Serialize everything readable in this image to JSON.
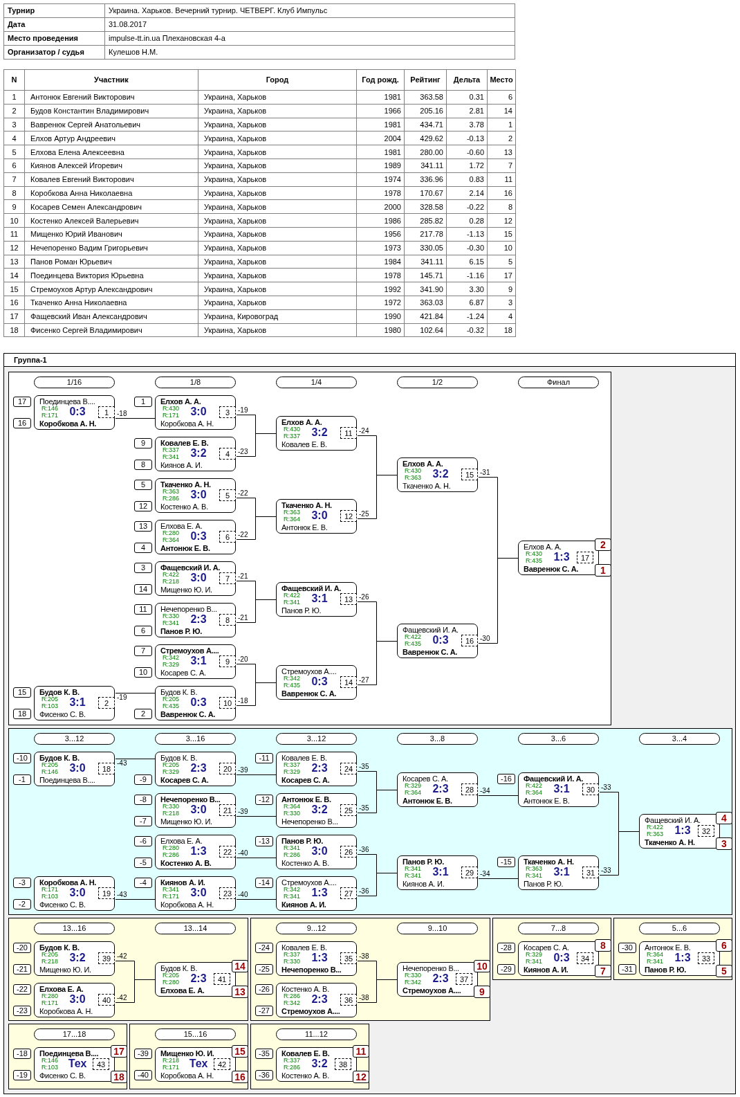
{
  "tournament_info": [
    {
      "label": "Турнир",
      "value": "Украина. Харьков. Вечерний турнир. ЧЕТВЕРГ. Клуб Импульс"
    },
    {
      "label": "Дата",
      "value": "31.08.2017"
    },
    {
      "label": "Место проведения",
      "value": "impulse-tt.in.ua Плехановская 4-а"
    },
    {
      "label": "Организатор / судья",
      "value": "Кулешов Н.М."
    }
  ],
  "participants": {
    "columns": [
      "N",
      "Участник",
      "Город",
      "Год рожд.",
      "Рейтинг",
      "Дельта",
      "Место"
    ],
    "rows": [
      [
        "1",
        "Антонюк Евгений Викторович",
        "Украина, Харьков",
        "1981",
        "363.58",
        "0.31",
        "6"
      ],
      [
        "2",
        "Будов Константин Владимирович",
        "Украина, Харьков",
        "1966",
        "205.16",
        "2.81",
        "14"
      ],
      [
        "3",
        "Вавренюк Сергей Анатольевич",
        "Украина, Харьков",
        "1981",
        "434.71",
        "3.78",
        "1"
      ],
      [
        "4",
        "Елхов Артур Андреевич",
        "Украина, Харьков",
        "2004",
        "429.62",
        "-0.13",
        "2"
      ],
      [
        "5",
        "Елхова Елена Алексеевна",
        "Украина, Харьков",
        "1981",
        "280.00",
        "-0.60",
        "13"
      ],
      [
        "6",
        "Киянов Алексей Игоревич",
        "Украина, Харьков",
        "1989",
        "341.11",
        "1.72",
        "7"
      ],
      [
        "7",
        "Ковалев Евгений Викторович",
        "Украина, Харьков",
        "1974",
        "336.96",
        "0.83",
        "11"
      ],
      [
        "8",
        "Коробкова Анна Николаевна",
        "Украина, Харьков",
        "1978",
        "170.67",
        "2.14",
        "16"
      ],
      [
        "9",
        "Косарев Семен Александрович",
        "Украина, Харьков",
        "2000",
        "328.58",
        "-0.22",
        "8"
      ],
      [
        "10",
        "Костенко Алексей Валерьевич",
        "Украина, Харьков",
        "1986",
        "285.82",
        "0.28",
        "12"
      ],
      [
        "11",
        "Мищенко Юрий Иванович",
        "Украина, Харьков",
        "1956",
        "217.78",
        "-1.13",
        "15"
      ],
      [
        "12",
        "Нечепоренко Вадим Григорьевич",
        "Украина, Харьков",
        "1973",
        "330.05",
        "-0.30",
        "10"
      ],
      [
        "13",
        "Панов Роман Юрьевич",
        "Украина, Харьков",
        "1984",
        "341.11",
        "6.15",
        "5"
      ],
      [
        "14",
        "Поединцева Виктория Юрьевна",
        "Украина, Харьков",
        "1978",
        "145.71",
        "-1.16",
        "17"
      ],
      [
        "15",
        "Стремоухов Артур Александрович",
        "Украина, Харьков",
        "1992",
        "341.90",
        "3.30",
        "9"
      ],
      [
        "16",
        "Ткаченко Анна Николаевна",
        "Украина, Харьков",
        "1972",
        "363.03",
        "6.87",
        "3"
      ],
      [
        "17",
        "Фащевский Иван Александрович",
        "Украина, Кировоград",
        "1990",
        "421.84",
        "-1.24",
        "4"
      ],
      [
        "18",
        "Фисенко Сергей Владимирович",
        "Украина, Харьков",
        "1980",
        "102.64",
        "-0.32",
        "18"
      ]
    ]
  },
  "group": {
    "title": "Группа-1",
    "panels": [
      {
        "color": "#ffffff",
        "rounds": [
          {
            "label": "1/16",
            "matches": [
              {
                "number": "1",
                "score": "0:3",
                "loser_to": "-18",
                "top": {
                  "source": "17",
                  "name": "Поединцева В....",
                  "rating": "R:146",
                  "winner": false
                },
                "bottom": {
                  "source": "16",
                  "name": "Коробкова А. Н.",
                  "rating": "R:171",
                  "winner": true
                }
              },
              {
                "number": "2",
                "score": "3:1",
                "loser_to": "-19",
                "top": {
                  "source": "15",
                  "name": "Будов К. В.",
                  "rating": "R:205",
                  "winner": true
                },
                "bottom": {
                  "source": "18",
                  "name": "Фисенко С. В.",
                  "rating": "R:103",
                  "winner": false
                }
              }
            ]
          },
          {
            "label": "1/8",
            "matches": [
              {
                "number": "3",
                "score": "3:0",
                "loser_to": "-19",
                "top": {
                  "source": "1",
                  "name": "Елхов А. А.",
                  "rating": "R:430",
                  "winner": true
                },
                "bottom": {
                  "name": "Коробкова А. Н.",
                  "rating": "R:171",
                  "winner": false
                }
              },
              {
                "number": "4",
                "score": "3:2",
                "loser_to": "-23",
                "top": {
                  "source": "9",
                  "name": "Ковалев Е. В.",
                  "rating": "R:337",
                  "winner": true
                },
                "bottom": {
                  "source": "8",
                  "name": "Киянов А. И.",
                  "rating": "R:341",
                  "winner": false
                }
              },
              {
                "number": "5",
                "score": "3:0",
                "loser_to": "-22",
                "top": {
                  "source": "5",
                  "name": "Ткаченко А. Н.",
                  "rating": "R:363",
                  "winner": true
                },
                "bottom": {
                  "source": "12",
                  "name": "Костенко А. В.",
                  "rating": "R:286",
                  "winner": false
                }
              },
              {
                "number": "6",
                "score": "0:3",
                "loser_to": "-22",
                "top": {
                  "source": "13",
                  "name": "Елхова Е. А.",
                  "rating": "R:280",
                  "winner": false
                },
                "bottom": {
                  "source": "4",
                  "name": "Антонюк Е. В.",
                  "rating": "R:364",
                  "winner": true
                }
              },
              {
                "number": "7",
                "score": "3:0",
                "loser_to": "-21",
                "top": {
                  "source": "3",
                  "name": "Фащевский И. А.",
                  "rating": "R:422",
                  "winner": true
                },
                "bottom": {
                  "source": "14",
                  "name": "Мищенко Ю. И.",
                  "rating": "R:218",
                  "winner": false
                }
              },
              {
                "number": "8",
                "score": "2:3",
                "loser_to": "-21",
                "top": {
                  "source": "11",
                  "name": "Нечепоренко В...",
                  "rating": "R:330",
                  "winner": false
                },
                "bottom": {
                  "source": "6",
                  "name": "Панов Р. Ю.",
                  "rating": "R:341",
                  "winner": true
                }
              },
              {
                "number": "9",
                "score": "3:1",
                "loser_to": "-20",
                "top": {
                  "source": "7",
                  "name": "Стремоухов А....",
                  "rating": "R:342",
                  "winner": true
                },
                "bottom": {
                  "source": "10",
                  "name": "Косарев С. А.",
                  "rating": "R:329",
                  "winner": false
                }
              },
              {
                "number": "10",
                "score": "0:3",
                "loser_to": "-18",
                "top": {
                  "name": "Будов К. В.",
                  "rating": "R:205",
                  "winner": false
                },
                "bottom": {
                  "source": "2",
                  "name": "Вавренюк С. А.",
                  "rating": "R:435",
                  "winner": true
                }
              }
            ]
          },
          {
            "label": "1/4",
            "matches": [
              {
                "number": "11",
                "score": "3:2",
                "loser_to": "-24",
                "top": {
                  "name": "Елхов А. А.",
                  "rating": "R:430",
                  "winner": true
                },
                "bottom": {
                  "name": "Ковалев Е. В.",
                  "rating": "R:337",
                  "winner": false
                }
              },
              {
                "number": "12",
                "score": "3:0",
                "loser_to": "-25",
                "top": {
                  "name": "Ткаченко А. Н.",
                  "rating": "R:363",
                  "winner": true
                },
                "bottom": {
                  "name": "Антонюк Е. В.",
                  "rating": "R:364",
                  "winner": false
                }
              },
              {
                "number": "13",
                "score": "3:1",
                "loser_to": "-26",
                "top": {
                  "name": "Фащевский И. А.",
                  "rating": "R:422",
                  "winner": true
                },
                "bottom": {
                  "name": "Панов Р. Ю.",
                  "rating": "R:341",
                  "winner": false
                }
              },
              {
                "number": "14",
                "score": "0:3",
                "loser_to": "-27",
                "top": {
                  "name": "Стремоухов А....",
                  "rating": "R:342",
                  "winner": false
                },
                "bottom": {
                  "name": "Вавренюк С. А.",
                  "rating": "R:435",
                  "winner": true
                }
              }
            ]
          },
          {
            "label": "1/2",
            "matches": [
              {
                "number": "15",
                "score": "3:2",
                "loser_to": "-31",
                "top": {
                  "name": "Елхов А. А.",
                  "rating": "R:430",
                  "winner": true
                },
                "bottom": {
                  "name": "Ткаченко А. Н.",
                  "rating": "R:363",
                  "winner": false
                }
              },
              {
                "number": "16",
                "score": "0:3",
                "loser_to": "-30",
                "top": {
                  "name": "Фащевский И. А.",
                  "rating": "R:422",
                  "winner": false
                },
                "bottom": {
                  "name": "Вавренюк С. А.",
                  "rating": "R:435",
                  "winner": true
                }
              }
            ]
          },
          {
            "label": "Финал",
            "matches": [
              {
                "number": "17",
                "score": "1:3",
                "top": {
                  "name": "Елхов А. А.",
                  "rating": "R:430",
                  "winner": false,
                  "place": "2"
                },
                "bottom": {
                  "name": "Вавренюк С. А.",
                  "rating": "R:435",
                  "winner": true,
                  "place": "1"
                }
              }
            ]
          }
        ]
      },
      {
        "color": "#e0ffff",
        "rounds": [
          {
            "label": "3...12",
            "matches": [
              {
                "number": "18",
                "score": "3:0",
                "loser_to": "-43",
                "top": {
                  "source": "-10",
                  "name": "Будов К. В.",
                  "rating": "R:205",
                  "winner": true
                },
                "bottom": {
                  "source": "-1",
                  "name": "Поединцева В....",
                  "rating": "R:146",
                  "winner": false
                }
              },
              {
                "number": "19",
                "score": "3:0",
                "loser_to": "-43",
                "top": {
                  "source": "-3",
                  "name": "Коробкова А. Н.",
                  "rating": "R:171",
                  "winner": true
                },
                "bottom": {
                  "source": "-2",
                  "name": "Фисенко С. В.",
                  "rating": "R:103",
                  "winner": false
                }
              }
            ]
          },
          {
            "label": "3...16",
            "matches": [
              {
                "number": "20",
                "score": "2:3",
                "loser_to": "-39",
                "top": {
                  "name": "Будов К. В.",
                  "rating": "R:205",
                  "winner": false
                },
                "bottom": {
                  "source": "-9",
                  "name": "Косарев С. А.",
                  "rating": "R:329",
                  "winner": true
                }
              },
              {
                "number": "21",
                "score": "3:0",
                "loser_to": "-39",
                "top": {
                  "source": "-8",
                  "name": "Нечепоренко В...",
                  "rating": "R:330",
                  "winner": true
                },
                "bottom": {
                  "source": "-7",
                  "name": "Мищенко Ю. И.",
                  "rating": "R:218",
                  "winner": false
                }
              },
              {
                "number": "22",
                "score": "1:3",
                "loser_to": "-40",
                "top": {
                  "source": "-6",
                  "name": "Елхова Е. А.",
                  "rating": "R:280",
                  "winner": false
                },
                "bottom": {
                  "source": "-5",
                  "name": "Костенко А. В.",
                  "rating": "R:286",
                  "winner": true
                }
              },
              {
                "number": "23",
                "score": "3:0",
                "loser_to": "-40",
                "top": {
                  "source": "-4",
                  "name": "Киянов А. И.",
                  "rating": "R:341",
                  "winner": true
                },
                "bottom": {
                  "name": "Коробкова А. Н.",
                  "rating": "R:171",
                  "winner": false
                }
              }
            ]
          },
          {
            "label": "3...12",
            "matches": [
              {
                "number": "24",
                "score": "2:3",
                "loser_to": "-35",
                "top": {
                  "source": "-11",
                  "name": "Ковалев Е. В.",
                  "rating": "R:337",
                  "winner": false
                },
                "bottom": {
                  "name": "Косарев С. А.",
                  "rating": "R:329",
                  "winner": true
                }
              },
              {
                "number": "25",
                "score": "3:2",
                "loser_to": "-35",
                "top": {
                  "source": "-12",
                  "name": "Антонюк Е. В.",
                  "rating": "R:364",
                  "winner": true
                },
                "bottom": {
                  "name": "Нечепоренко В...",
                  "rating": "R:330",
                  "winner": false
                }
              },
              {
                "number": "26",
                "score": "3:0",
                "loser_to": "-36",
                "top": {
                  "source": "-13",
                  "name": "Панов Р. Ю.",
                  "rating": "R:341",
                  "winner": true
                },
                "bottom": {
                  "name": "Костенко А. В.",
                  "rating": "R:286",
                  "winner": false
                }
              },
              {
                "number": "27",
                "score": "1:3",
                "loser_to": "-36",
                "top": {
                  "source": "-14",
                  "name": "Стремоухов А....",
                  "rating": "R:342",
                  "winner": false
                },
                "bottom": {
                  "name": "Киянов А. И.",
                  "rating": "R:341",
                  "winner": true
                }
              }
            ]
          },
          {
            "label": "3...8",
            "matches": [
              {
                "number": "28",
                "score": "2:3",
                "loser_to": "-34",
                "top": {
                  "name": "Косарев С. А.",
                  "rating": "R:329",
                  "winner": false
                },
                "bottom": {
                  "name": "Антонюк Е. В.",
                  "rating": "R:364",
                  "winner": true
                }
              },
              {
                "number": "29",
                "score": "3:1",
                "loser_to": "-34",
                "top": {
                  "name": "Панов Р. Ю.",
                  "rating": "R:341",
                  "winner": true
                },
                "bottom": {
                  "name": "Киянов А. И.",
                  "rating": "R:341",
                  "winner": false
                }
              }
            ]
          },
          {
            "label": "3...6",
            "matches": [
              {
                "number": "30",
                "score": "3:1",
                "loser_to": "-33",
                "top": {
                  "source": "-16",
                  "name": "Фащевский И. А.",
                  "rating": "R:422",
                  "winner": true
                },
                "bottom": {
                  "name": "Антонюк Е. В.",
                  "rating": "R:364",
                  "winner": false
                }
              },
              {
                "number": "31",
                "score": "3:1",
                "loser_to": "-33",
                "top": {
                  "source": "-15",
                  "name": "Ткаченко А. Н.",
                  "rating": "R:363",
                  "winner": true
                },
                "bottom": {
                  "name": "Панов Р. Ю.",
                  "rating": "R:341",
                  "winner": false
                }
              }
            ]
          },
          {
            "label": "3...4",
            "matches": [
              {
                "number": "32",
                "score": "1:3",
                "top": {
                  "name": "Фащевский И. А.",
                  "rating": "R:422",
                  "winner": false,
                  "place": "4"
                },
                "bottom": {
                  "name": "Ткаченко А. Н.",
                  "rating": "R:363",
                  "winner": true,
                  "place": "3"
                }
              }
            ]
          }
        ]
      },
      {
        "color": "#ffffe0",
        "rounds": [
          {
            "label": "13...16",
            "matches": [
              {
                "number": "39",
                "score": "3:2",
                "loser_to": "-42",
                "top": {
                  "source": "-20",
                  "name": "Будов К. В.",
                  "rating": "R:205",
                  "winner": true
                },
                "bottom": {
                  "source": "-21",
                  "name": "Мищенко Ю. И.",
                  "rating": "R:218",
                  "winner": false
                }
              },
              {
                "number": "40",
                "score": "3:0",
                "loser_to": "-42",
                "top": {
                  "source": "-22",
                  "name": "Елхова Е. А.",
                  "rating": "R:280",
                  "winner": true
                },
                "bottom": {
                  "source": "-23",
                  "name": "Коробкова А. Н.",
                  "rating": "R:171",
                  "winner": false
                }
              }
            ]
          },
          {
            "label": "13...14",
            "matches": [
              {
                "number": "41",
                "score": "2:3",
                "top": {
                  "name": "Будов К. В.",
                  "rating": "R:205",
                  "winner": false,
                  "place": "14"
                },
                "bottom": {
                  "name": "Елхова Е. А.",
                  "rating": "R:280",
                  "winner": true,
                  "place": "13"
                }
              }
            ]
          }
        ]
      },
      {
        "color": "#ffffe0",
        "rounds": [
          {
            "label": "9...12",
            "matches": [
              {
                "number": "35",
                "score": "1:3",
                "loser_to": "-38",
                "top": {
                  "source": "-24",
                  "name": "Ковалев Е. В.",
                  "rating": "R:337",
                  "winner": false
                },
                "bottom": {
                  "source": "-25",
                  "name": "Нечепоренко В...",
                  "rating": "R:330",
                  "winner": true
                }
              },
              {
                "number": "36",
                "score": "2:3",
                "loser_to": "-38",
                "top": {
                  "source": "-26",
                  "name": "Костенко А. В.",
                  "rating": "R:286",
                  "winner": false
                },
                "bottom": {
                  "source": "-27",
                  "name": "Стремоухов А....",
                  "rating": "R:342",
                  "winner": true
                }
              }
            ]
          },
          {
            "label": "9...10",
            "matches": [
              {
                "number": "37",
                "score": "2:3",
                "top": {
                  "name": "Нечепоренко В...",
                  "rating": "R:330",
                  "winner": false,
                  "place": "10"
                },
                "bottom": {
                  "name": "Стремоухов А....",
                  "rating": "R:342",
                  "winner": true,
                  "place": "9"
                }
              }
            ]
          }
        ]
      },
      {
        "color": "#ffffe0",
        "rounds": [
          {
            "label": "7...8",
            "matches": [
              {
                "number": "34",
                "score": "0:3",
                "top": {
                  "source": "-28",
                  "name": "Косарев С. А.",
                  "rating": "R:329",
                  "winner": false,
                  "place": "8"
                },
                "bottom": {
                  "source": "-29",
                  "name": "Киянов А. И.",
                  "rating": "R:341",
                  "winner": true,
                  "place": "7"
                }
              }
            ]
          }
        ]
      },
      {
        "color": "#ffffe0",
        "rounds": [
          {
            "label": "5...6",
            "matches": [
              {
                "number": "33",
                "score": "1:3",
                "top": {
                  "source": "-30",
                  "name": "Антонюк Е. В.",
                  "rating": "R:364",
                  "winner": false,
                  "place": "6"
                },
                "bottom": {
                  "source": "-31",
                  "name": "Панов Р. Ю.",
                  "rating": "R:341",
                  "winner": true,
                  "place": "5"
                }
              }
            ]
          }
        ]
      },
      {
        "color": "#ffffe0",
        "rounds": [
          {
            "label": "17...18",
            "matches": [
              {
                "number": "43",
                "score": "Тех",
                "top": {
                  "source": "-18",
                  "name": "Поединцева В....",
                  "rating": "R:146",
                  "winner": true,
                  "place": "17"
                },
                "bottom": {
                  "source": "-19",
                  "name": "Фисенко С. В.",
                  "rating": "R:103",
                  "winner": false,
                  "place": "18"
                }
              }
            ]
          }
        ]
      },
      {
        "color": "#ffffe0",
        "rounds": [
          {
            "label": "15...16",
            "matches": [
              {
                "number": "42",
                "score": "Тех",
                "top": {
                  "source": "-39",
                  "name": "Мищенко Ю. И.",
                  "rating": "R:218",
                  "winner": true,
                  "place": "15"
                },
                "bottom": {
                  "source": "-40",
                  "name": "Коробкова А. Н.",
                  "rating": "R:171",
                  "winner": false,
                  "place": "16"
                }
              }
            ]
          }
        ]
      },
      {
        "color": "#ffffe0",
        "rounds": [
          {
            "label": "11...12",
            "matches": [
              {
                "number": "38",
                "score": "3:2",
                "top": {
                  "source": "-35",
                  "name": "Ковалев Е. В.",
                  "rating": "R:337",
                  "winner": true,
                  "place": "11"
                },
                "bottom": {
                  "source": "-36",
                  "name": "Костенко А. В.",
                  "rating": "R:286",
                  "winner": false,
                  "place": "12"
                }
              }
            ]
          }
        ]
      }
    ]
  }
}
